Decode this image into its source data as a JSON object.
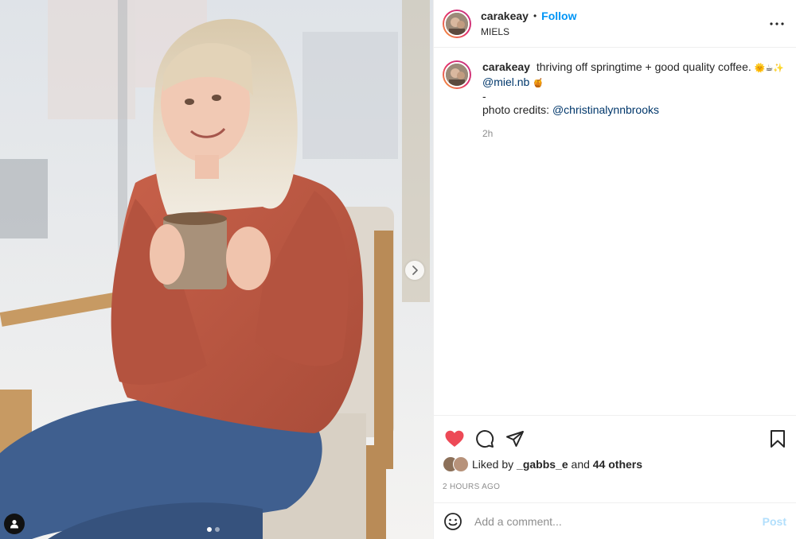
{
  "post": {
    "username": "carakeay",
    "follow_label": "Follow",
    "separator": "•",
    "location": "MIELS",
    "caption": {
      "text": "thriving off springtime + good quality coffee.",
      "emojis": "🌞☕✨",
      "mention_1": "@miel.nb",
      "emoji_2": "🍯",
      "dash": "-",
      "credits_prefix": "photo credits:",
      "mention_2": "@christinalynnbrooks"
    },
    "caption_age": "2h",
    "likes": {
      "prefix": "Liked by",
      "first_liker": "_gabbs_e",
      "joiner": "and",
      "others": "44 others"
    },
    "timestamp": "2 HOURS AGO",
    "comment_placeholder": "Add a comment...",
    "post_label": "Post",
    "carousel": {
      "count": 2,
      "active_index": 0
    }
  },
  "icons": {
    "more": "more-options-icon",
    "like": "heart-filled-icon",
    "comment": "comment-bubble-icon",
    "share": "paper-plane-icon",
    "save": "bookmark-icon",
    "emoji": "smiley-icon",
    "next": "chevron-right-icon",
    "tagged": "user-tag-icon"
  },
  "colors": {
    "accent": "#0095f6",
    "like": "#ed4956",
    "mention": "#00376b",
    "muted": "#8e8e8e",
    "post_disabled": "#b2dffc"
  }
}
